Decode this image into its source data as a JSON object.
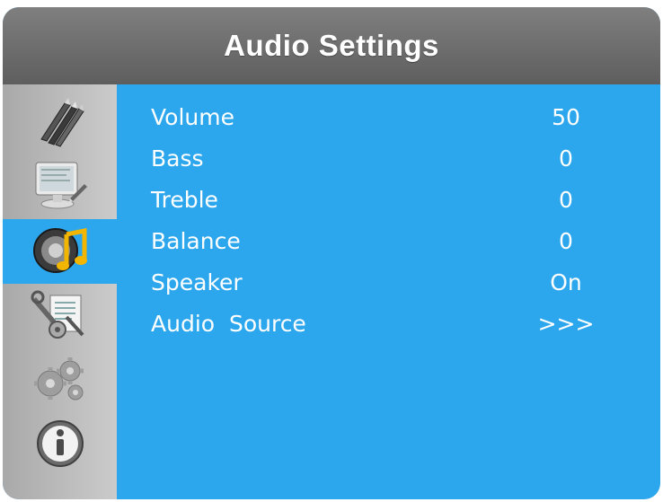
{
  "header": {
    "title": "Audio Settings"
  },
  "sidebar": {
    "items": [
      {
        "icon": "pens-icon",
        "label": ""
      },
      {
        "icon": "monitor-icon",
        "label": ""
      },
      {
        "icon": "audio-icon",
        "label": ""
      },
      {
        "icon": "tools-icon",
        "label": ""
      },
      {
        "icon": "gears-icon",
        "label": ""
      },
      {
        "icon": "info-icon",
        "label": ""
      }
    ],
    "active_index": 2
  },
  "menu": {
    "items": [
      {
        "label": "Volume",
        "value": "50"
      },
      {
        "label": "Bass",
        "value": "0"
      },
      {
        "label": "Treble",
        "value": "0"
      },
      {
        "label": "Balance",
        "value": "0"
      },
      {
        "label": "Speaker",
        "value": "On"
      },
      {
        "label": "Audio  Source",
        "value": ">>>"
      }
    ]
  },
  "colors": {
    "background": "#2ca6ec",
    "header": "#6e6e6e",
    "sidebar": "#bcbcbc",
    "text": "#ffffff"
  }
}
